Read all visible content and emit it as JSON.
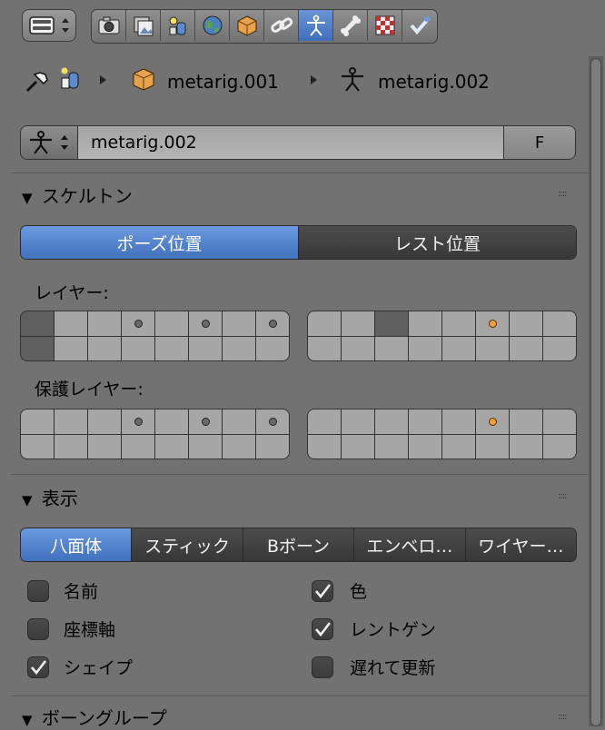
{
  "toolbar": {
    "editor_selector_icon": "editor-type-icon",
    "tabs": [
      {
        "icon": "render-icon",
        "active": false
      },
      {
        "icon": "render-layers-icon",
        "active": false
      },
      {
        "icon": "scene-icon",
        "active": false
      },
      {
        "icon": "world-icon",
        "active": false
      },
      {
        "icon": "object-icon",
        "active": false
      },
      {
        "icon": "constraints-icon",
        "active": false
      },
      {
        "icon": "armature-data-icon",
        "active": true
      },
      {
        "icon": "bone-icon",
        "active": false
      },
      {
        "icon": "texture-icon",
        "active": false
      },
      {
        "icon": "modifier-icon",
        "active": false
      }
    ]
  },
  "breadcrumb": {
    "object": "metarig.001",
    "data": "metarig.002"
  },
  "datablock": {
    "name": "metarig.002",
    "fake_user": "F"
  },
  "skeleton": {
    "title": "スケルトン",
    "pose_position": "ポーズ位置",
    "rest_position": "レスト位置",
    "layers_label": "レイヤー:",
    "protected_layers_label": "保護レイヤー:"
  },
  "display": {
    "title": "表示",
    "modes": [
      "八面体",
      "スティック",
      "Bボーン",
      "エンベロ…",
      "ワイヤー…"
    ],
    "active_mode": "八面体",
    "options": [
      {
        "label": "名前",
        "checked": false
      },
      {
        "label": "色",
        "checked": true
      },
      {
        "label": "座標軸",
        "checked": false
      },
      {
        "label": "レントゲン",
        "checked": true
      },
      {
        "label": "シェイプ",
        "checked": true
      },
      {
        "label": "遅れて更新",
        "checked": false
      }
    ]
  },
  "bone_groups": {
    "title": "ボーングループ"
  },
  "colors": {
    "accent": "#5080c8",
    "active_layer_dot": "#f0a040",
    "background": "#727272"
  }
}
